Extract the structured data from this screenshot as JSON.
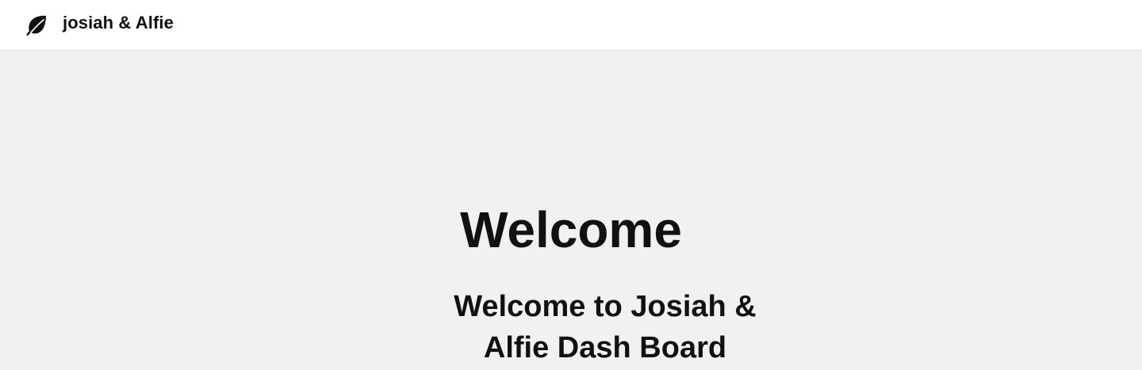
{
  "header": {
    "brand_name": "josiah & Alfie",
    "brand_icon": "leaf-icon"
  },
  "main": {
    "title": "Welcome",
    "subtitle": "Welcome to Josiah & Alfie Dash Board"
  },
  "colors": {
    "header_background": "#ffffff",
    "page_background": "#f1f1f1",
    "text": "#111111"
  }
}
